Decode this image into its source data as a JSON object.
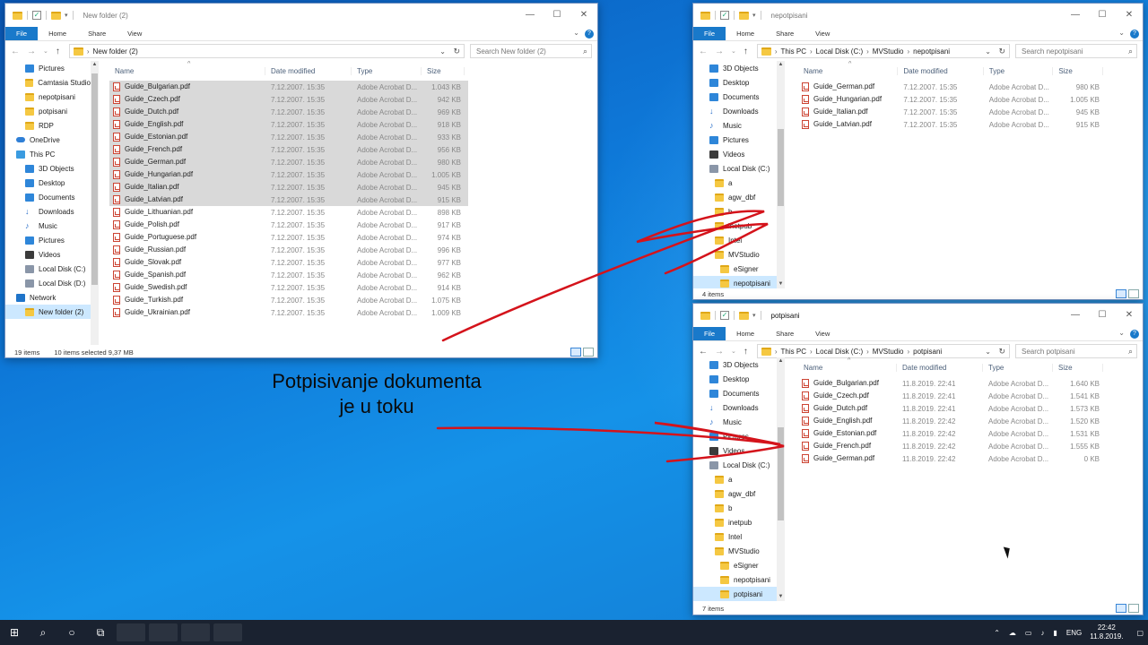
{
  "ribbon_tabs": {
    "file": "File",
    "home": "Home",
    "share": "Share",
    "view": "View"
  },
  "column_headers": {
    "name": "Name",
    "date": "Date modified",
    "type": "Type",
    "size": "Size"
  },
  "window1": {
    "title": "New folder (2)",
    "address": [
      "New folder (2)"
    ],
    "search_placeholder": "Search New folder (2)",
    "nav_items": [
      {
        "label": "Pictures",
        "icon": "pictures-icon",
        "indent": 1
      },
      {
        "label": "Camtasia Studio",
        "icon": "folder-icon",
        "indent": 1
      },
      {
        "label": "nepotpisani",
        "icon": "folder-icon",
        "indent": 1
      },
      {
        "label": "potpisani",
        "icon": "folder-icon",
        "indent": 1
      },
      {
        "label": "RDP",
        "icon": "folder-icon",
        "indent": 1
      },
      {
        "label": "OneDrive",
        "icon": "cloud-icon",
        "indent": 0
      },
      {
        "label": "This PC",
        "icon": "pc-icon",
        "indent": 0
      },
      {
        "label": "3D Objects",
        "icon": "3d-objects-icon",
        "indent": 1
      },
      {
        "label": "Desktop",
        "icon": "desktop-icon",
        "indent": 1
      },
      {
        "label": "Documents",
        "icon": "documents-icon",
        "indent": 1
      },
      {
        "label": "Downloads",
        "icon": "downloads-icon",
        "indent": 1
      },
      {
        "label": "Music",
        "icon": "music-icon",
        "indent": 1
      },
      {
        "label": "Pictures",
        "icon": "pictures-icon",
        "indent": 1
      },
      {
        "label": "Videos",
        "icon": "videos-icon",
        "indent": 1
      },
      {
        "label": "Local Disk (C:)",
        "icon": "drive-icon",
        "indent": 1
      },
      {
        "label": "Local Disk (D:)",
        "icon": "drive-icon",
        "indent": 1
      },
      {
        "label": "Network",
        "icon": "network-icon",
        "indent": 0
      },
      {
        "label": "New folder (2)",
        "icon": "folder-icon",
        "indent": 1,
        "selected": true
      }
    ],
    "files": [
      {
        "name": "Guide_Bulgarian.pdf",
        "date": "7.12.2007. 15:35",
        "type": "Adobe Acrobat D...",
        "size": "1.043 KB",
        "selected": true
      },
      {
        "name": "Guide_Czech.pdf",
        "date": "7.12.2007. 15:35",
        "type": "Adobe Acrobat D...",
        "size": "942 KB",
        "selected": true
      },
      {
        "name": "Guide_Dutch.pdf",
        "date": "7.12.2007. 15:35",
        "type": "Adobe Acrobat D...",
        "size": "969 KB",
        "selected": true
      },
      {
        "name": "Guide_English.pdf",
        "date": "7.12.2007. 15:35",
        "type": "Adobe Acrobat D...",
        "size": "918 KB",
        "selected": true
      },
      {
        "name": "Guide_Estonian.pdf",
        "date": "7.12.2007. 15:35",
        "type": "Adobe Acrobat D...",
        "size": "933 KB",
        "selected": true
      },
      {
        "name": "Guide_French.pdf",
        "date": "7.12.2007. 15:35",
        "type": "Adobe Acrobat D...",
        "size": "956 KB",
        "selected": true
      },
      {
        "name": "Guide_German.pdf",
        "date": "7.12.2007. 15:35",
        "type": "Adobe Acrobat D...",
        "size": "980 KB",
        "selected": true
      },
      {
        "name": "Guide_Hungarian.pdf",
        "date": "7.12.2007. 15:35",
        "type": "Adobe Acrobat D...",
        "size": "1.005 KB",
        "selected": true
      },
      {
        "name": "Guide_Italian.pdf",
        "date": "7.12.2007. 15:35",
        "type": "Adobe Acrobat D...",
        "size": "945 KB",
        "selected": true
      },
      {
        "name": "Guide_Latvian.pdf",
        "date": "7.12.2007. 15:35",
        "type": "Adobe Acrobat D...",
        "size": "915 KB",
        "selected": true
      },
      {
        "name": "Guide_Lithuanian.pdf",
        "date": "7.12.2007. 15:35",
        "type": "Adobe Acrobat D...",
        "size": "898 KB"
      },
      {
        "name": "Guide_Polish.pdf",
        "date": "7.12.2007. 15:35",
        "type": "Adobe Acrobat D...",
        "size": "917 KB"
      },
      {
        "name": "Guide_Portuguese.pdf",
        "date": "7.12.2007. 15:35",
        "type": "Adobe Acrobat D...",
        "size": "974 KB"
      },
      {
        "name": "Guide_Russian.pdf",
        "date": "7.12.2007. 15:35",
        "type": "Adobe Acrobat D...",
        "size": "996 KB"
      },
      {
        "name": "Guide_Slovak.pdf",
        "date": "7.12.2007. 15:35",
        "type": "Adobe Acrobat D...",
        "size": "977 KB"
      },
      {
        "name": "Guide_Spanish.pdf",
        "date": "7.12.2007. 15:35",
        "type": "Adobe Acrobat D...",
        "size": "962 KB"
      },
      {
        "name": "Guide_Swedish.pdf",
        "date": "7.12.2007. 15:35",
        "type": "Adobe Acrobat D...",
        "size": "914 KB"
      },
      {
        "name": "Guide_Turkish.pdf",
        "date": "7.12.2007. 15:35",
        "type": "Adobe Acrobat D...",
        "size": "1.075 KB"
      },
      {
        "name": "Guide_Ukrainian.pdf",
        "date": "7.12.2007. 15:35",
        "type": "Adobe Acrobat D...",
        "size": "1.009 KB"
      }
    ],
    "status_count": "19 items",
    "status_selection": "10 items selected  9,37 MB"
  },
  "window2": {
    "title": "nepotpisani",
    "address": [
      "This PC",
      "Local Disk (C:)",
      "MVStudio",
      "nepotpisani"
    ],
    "search_placeholder": "Search nepotpisani",
    "nav_items": [
      {
        "label": "3D Objects",
        "icon": "3d-objects-icon",
        "indent": 1
      },
      {
        "label": "Desktop",
        "icon": "desktop-icon",
        "indent": 1
      },
      {
        "label": "Documents",
        "icon": "documents-icon",
        "indent": 1
      },
      {
        "label": "Downloads",
        "icon": "downloads-icon",
        "indent": 1
      },
      {
        "label": "Music",
        "icon": "music-icon",
        "indent": 1
      },
      {
        "label": "Pictures",
        "icon": "pictures-icon",
        "indent": 1
      },
      {
        "label": "Videos",
        "icon": "videos-icon",
        "indent": 1
      },
      {
        "label": "Local Disk (C:)",
        "icon": "drive-icon",
        "indent": 1
      },
      {
        "label": "a",
        "icon": "folder-icon",
        "indent": 2
      },
      {
        "label": "agw_dbf",
        "icon": "folder-icon",
        "indent": 2
      },
      {
        "label": "b",
        "icon": "folder-icon",
        "indent": 2
      },
      {
        "label": "inetpub",
        "icon": "folder-icon",
        "indent": 2
      },
      {
        "label": "Intel",
        "icon": "folder-icon",
        "indent": 2
      },
      {
        "label": "MVStudio",
        "icon": "folder-icon",
        "indent": 2
      },
      {
        "label": "eSigner",
        "icon": "folder-icon",
        "indent": 3
      },
      {
        "label": "nepotpisani",
        "icon": "folder-icon",
        "indent": 3,
        "selected": true
      }
    ],
    "files": [
      {
        "name": "Guide_German.pdf",
        "date": "7.12.2007. 15:35",
        "type": "Adobe Acrobat D...",
        "size": "980 KB"
      },
      {
        "name": "Guide_Hungarian.pdf",
        "date": "7.12.2007. 15:35",
        "type": "Adobe Acrobat D...",
        "size": "1.005 KB"
      },
      {
        "name": "Guide_Italian.pdf",
        "date": "7.12.2007. 15:35",
        "type": "Adobe Acrobat D...",
        "size": "945 KB"
      },
      {
        "name": "Guide_Latvian.pdf",
        "date": "7.12.2007. 15:35",
        "type": "Adobe Acrobat D...",
        "size": "915 KB"
      }
    ],
    "status_count": "4 items"
  },
  "window3": {
    "title": "potpisani",
    "address": [
      "This PC",
      "Local Disk (C:)",
      "MVStudio",
      "potpisani"
    ],
    "search_placeholder": "Search potpisani",
    "nav_items": [
      {
        "label": "3D Objects",
        "icon": "3d-objects-icon",
        "indent": 1
      },
      {
        "label": "Desktop",
        "icon": "desktop-icon",
        "indent": 1
      },
      {
        "label": "Documents",
        "icon": "documents-icon",
        "indent": 1
      },
      {
        "label": "Downloads",
        "icon": "downloads-icon",
        "indent": 1
      },
      {
        "label": "Music",
        "icon": "music-icon",
        "indent": 1
      },
      {
        "label": "Pictures",
        "icon": "pictures-icon",
        "indent": 1
      },
      {
        "label": "Videos",
        "icon": "videos-icon",
        "indent": 1
      },
      {
        "label": "Local Disk (C:)",
        "icon": "drive-icon",
        "indent": 1
      },
      {
        "label": "a",
        "icon": "folder-icon",
        "indent": 2
      },
      {
        "label": "agw_dbf",
        "icon": "folder-icon",
        "indent": 2
      },
      {
        "label": "b",
        "icon": "folder-icon",
        "indent": 2
      },
      {
        "label": "inetpub",
        "icon": "folder-icon",
        "indent": 2
      },
      {
        "label": "Intel",
        "icon": "folder-icon",
        "indent": 2
      },
      {
        "label": "MVStudio",
        "icon": "folder-icon",
        "indent": 2
      },
      {
        "label": "eSigner",
        "icon": "folder-icon",
        "indent": 3
      },
      {
        "label": "nepotpisani",
        "icon": "folder-icon",
        "indent": 3
      },
      {
        "label": "potpisani",
        "icon": "folder-icon",
        "indent": 3,
        "selected": true
      }
    ],
    "files": [
      {
        "name": "Guide_Bulgarian.pdf",
        "date": "11.8.2019. 22:41",
        "type": "Adobe Acrobat D...",
        "size": "1.640 KB"
      },
      {
        "name": "Guide_Czech.pdf",
        "date": "11.8.2019. 22:41",
        "type": "Adobe Acrobat D...",
        "size": "1.541 KB"
      },
      {
        "name": "Guide_Dutch.pdf",
        "date": "11.8.2019. 22:41",
        "type": "Adobe Acrobat D...",
        "size": "1.573 KB"
      },
      {
        "name": "Guide_English.pdf",
        "date": "11.8.2019. 22:42",
        "type": "Adobe Acrobat D...",
        "size": "1.520 KB"
      },
      {
        "name": "Guide_Estonian.pdf",
        "date": "11.8.2019. 22:42",
        "type": "Adobe Acrobat D...",
        "size": "1.531 KB"
      },
      {
        "name": "Guide_French.pdf",
        "date": "11.8.2019. 22:42",
        "type": "Adobe Acrobat D...",
        "size": "1.555 KB"
      },
      {
        "name": "Guide_German.pdf",
        "date": "11.8.2019. 22:42",
        "type": "Adobe Acrobat D...",
        "size": "0 KB"
      }
    ],
    "status_count": "7 items"
  },
  "overlay_text": {
    "line1": "Potpisivanje dokumenta",
    "line2": "je u toku"
  },
  "annotation_color": "#d4131b",
  "taskbar": {
    "lang": "ENG",
    "time": "22:42",
    "date": "11.8.2019."
  }
}
